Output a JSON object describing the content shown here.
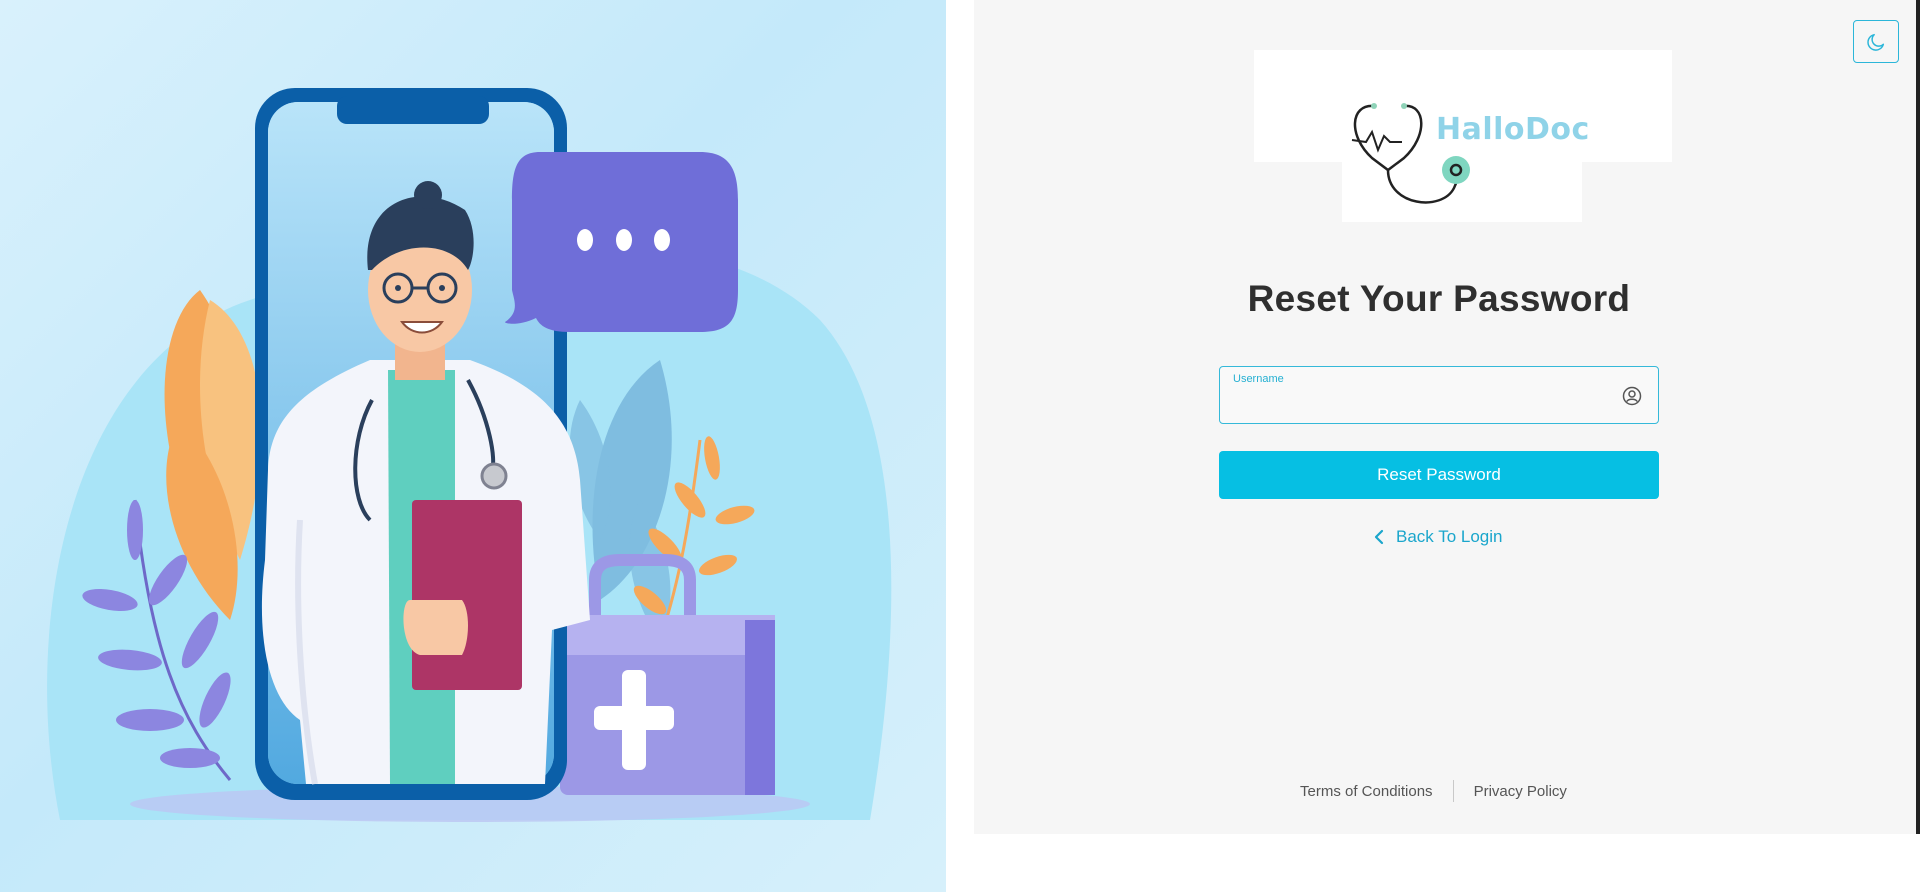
{
  "brand": {
    "name": "HalloDoc",
    "accent_color": "#06bfe3",
    "logo_text_color": "#8fd3e8"
  },
  "header": {
    "theme_toggle_icon": "moon-icon"
  },
  "form": {
    "title": "Reset Your Password",
    "username_label": "Username",
    "username_value": "",
    "username_icon": "user-circle-icon",
    "submit_label": "Reset Password",
    "back_label": "Back To Login",
    "back_icon": "chevron-left-icon"
  },
  "footer": {
    "terms": "Terms of Conditions",
    "privacy": "Privacy Policy"
  },
  "illustration": {
    "subject": "doctor-on-phone-illustration",
    "colors": {
      "phone": "#0b5fa8",
      "bubble": "#6f6ed8",
      "kit": "#9c98e6",
      "clipboard": "#ad3566",
      "leaf_orange": "#f5a85a",
      "leaf_purple": "#8c86e0"
    }
  }
}
